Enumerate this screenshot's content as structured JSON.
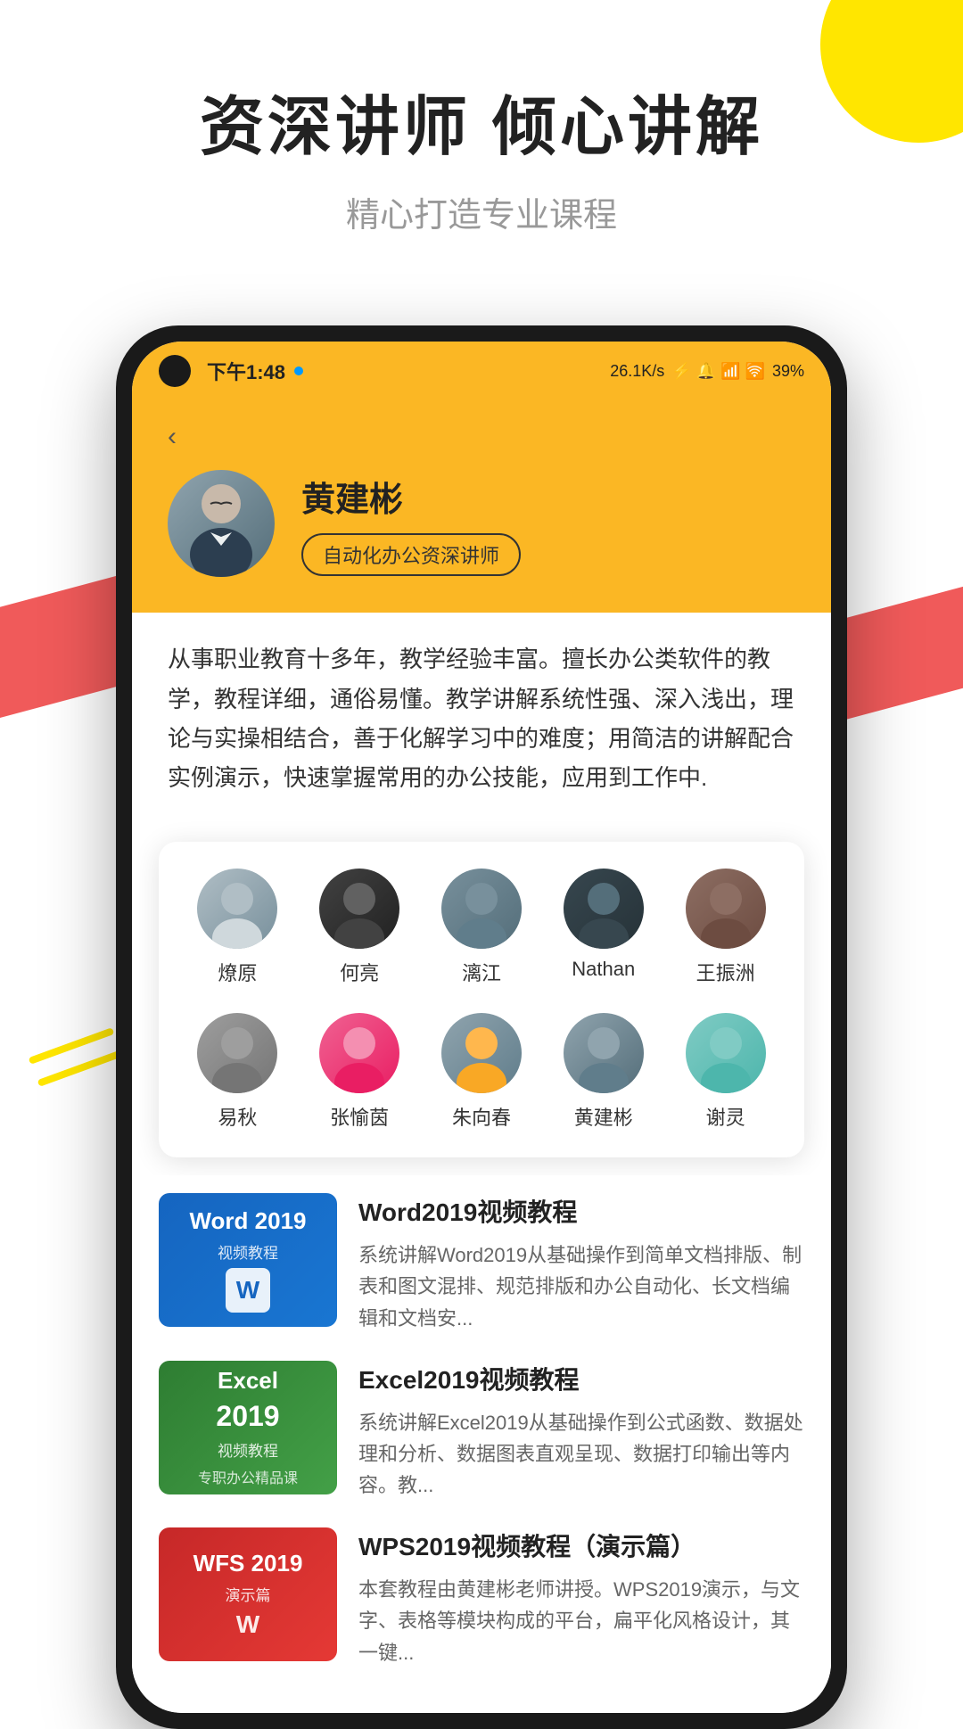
{
  "page": {
    "background_color": "#ffffff"
  },
  "decorations": {
    "circle_color": "#FFE600",
    "red_stripe_color": "#F05A5A"
  },
  "header": {
    "main_title": "资深讲师  倾心讲解",
    "sub_title": "精心打造专业课程"
  },
  "phone": {
    "status_bar": {
      "time": "下午1:48",
      "dot_color": "#0099ff",
      "speed": "26.1K/s",
      "battery": "39%"
    },
    "instructor": {
      "name": "黄建彬",
      "badge": "自动化办公资深讲师",
      "description": "从事职业教育十多年，教学经验丰富。擅长办公类软件的教学，教程详细，通俗易懂。教学讲解系统性强、深入浅出，理论与实操相结合，善于化解学习中的难度；用简洁的讲解配合实例演示，快速掌握常用的办公技能，应用到工作中.",
      "back_label": "‹"
    },
    "teachers": {
      "row1": [
        {
          "name": "燎原",
          "av_class": "av-1"
        },
        {
          "name": "何亮",
          "av_class": "av-2"
        },
        {
          "name": "漓江",
          "av_class": "av-3"
        },
        {
          "name": "Nathan",
          "av_class": "av-4"
        },
        {
          "name": "王振洲",
          "av_class": "av-5"
        }
      ],
      "row2": [
        {
          "name": "易秋",
          "av_class": "av-6"
        },
        {
          "name": "张愉茵",
          "av_class": "av-7"
        },
        {
          "name": "朱向春",
          "av_class": "av-8"
        },
        {
          "name": "黄建彬",
          "av_class": "av-instructor"
        },
        {
          "name": "谢灵",
          "av_class": "av-9"
        }
      ]
    },
    "courses": [
      {
        "id": "word2019",
        "thumb_type": "word",
        "thumb_title": "Word 2019",
        "thumb_subtitle": "视频教程",
        "title": "Word2019视频教程",
        "description": "系统讲解Word2019从基础操作到简单文档排版、制表和图文混排、规范排版和办公自动化、长文档编辑和文档安..."
      },
      {
        "id": "excel2019",
        "thumb_type": "excel",
        "thumb_title": "Excel",
        "thumb_subtitle": "2019\n视频教程",
        "title": "Excel2019视频教程",
        "description": "系统讲解Excel2019从基础操作到公式函数、数据处理和分析、数据图表直观呈现、数据打印输出等内容。教..."
      },
      {
        "id": "wps2019",
        "thumb_type": "wps",
        "thumb_title": "WPS 2019",
        "thumb_subtitle": "演示篇",
        "title": "WPS2019视频教程（演示篇）",
        "description": "本套教程由黄建彬老师讲授。WPS2019演示，与文字、表格等模块构成的平台，扁平化风格设计，其一键..."
      }
    ]
  }
}
